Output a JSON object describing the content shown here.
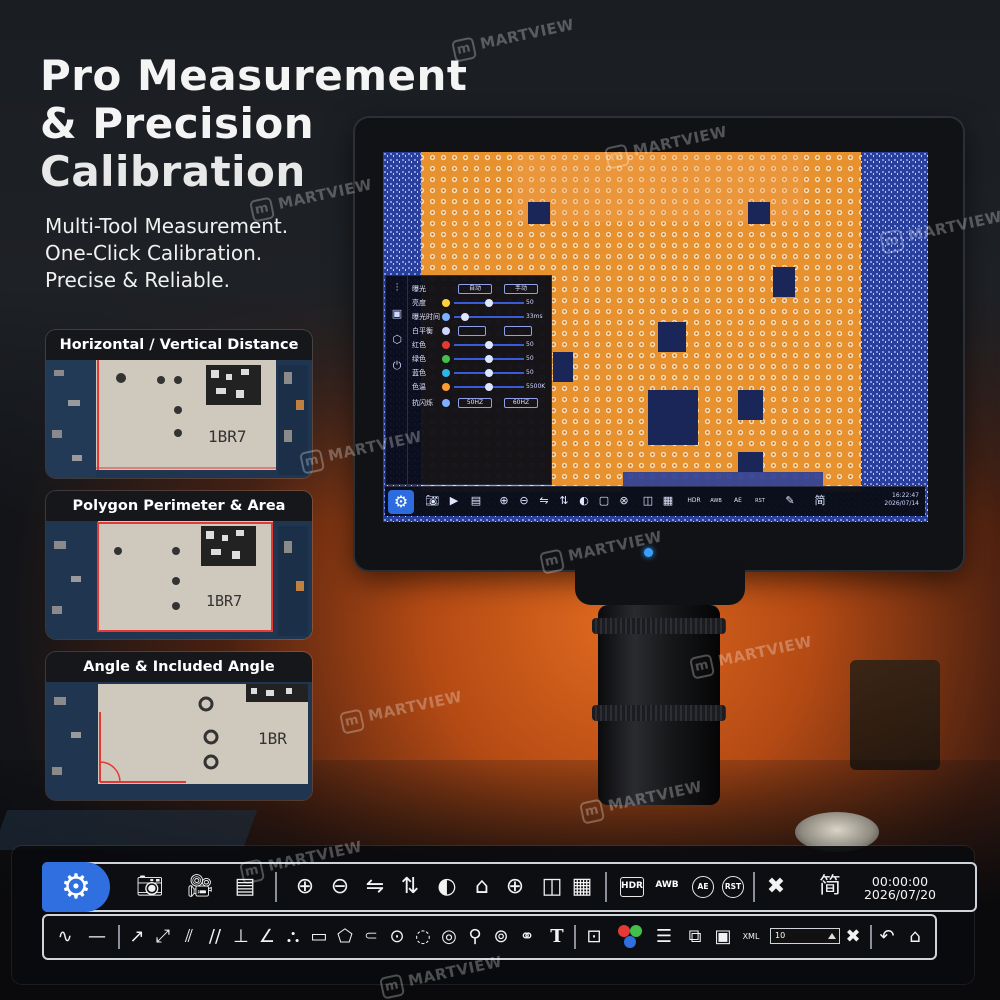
{
  "hero": {
    "title_line1": "Pro Measurement",
    "title_line2": "& Precision",
    "title_line3": "Calibration",
    "subtitle_line1": "Multi-Tool Measurement.",
    "subtitle_line2": "One-Click Calibration.",
    "subtitle_line3": "Precise & Reliable."
  },
  "cards": [
    {
      "label": "Horizontal / Vertical Distance",
      "chip_text": "1BR7"
    },
    {
      "label": "Polygon Perimeter & Area",
      "chip_text": "1BR7"
    },
    {
      "label": "Angle & Included Angle",
      "chip_text": "1BR"
    }
  ],
  "osd": {
    "rows": [
      {
        "label": "曝光",
        "left_option": "自动",
        "right_option": "手动"
      },
      {
        "label": "亮度",
        "value": "50",
        "level": 0.5,
        "icon_color": "#ffd23a"
      },
      {
        "label": "曝光时间",
        "value": "33ms",
        "level": 0.15,
        "icon_color": "#7fb0ff"
      },
      {
        "label": "白平衡",
        "value": "",
        "icon_color": "#cfd6ff"
      },
      {
        "label": "红色",
        "value": "50",
        "level": 0.5,
        "icon_color": "#e53935"
      },
      {
        "label": "绿色",
        "value": "50",
        "level": 0.5,
        "icon_color": "#43c04a"
      },
      {
        "label": "蓝色",
        "value": "50",
        "level": 0.5,
        "icon_color": "#2fb6e8"
      },
      {
        "label": "色温",
        "value": "5500K",
        "level": 0.5,
        "icon_color": "#ff9a2e"
      },
      {
        "label": "抗闪烁",
        "left_option": "50HZ",
        "right_option": "60HZ"
      }
    ]
  },
  "screen_toolbar": {
    "time": "16:22:47",
    "date": "2026/07/14",
    "lang": "简"
  },
  "toolbar": {
    "time": "00:00:00",
    "date": "2026/07/20",
    "lang_label": "简",
    "hdr_label": "HDR",
    "awb_label": "AWB",
    "ae_label": "AE",
    "rst_label": "RST",
    "xml_label": "XML",
    "line_width_value": "10",
    "text_tool_label": "T"
  },
  "watermark": {
    "brand": "MARTVIEW",
    "logo_letter": "m"
  },
  "colors": {
    "accent_blue": "#2f6fe0",
    "orange_bg": "#e0691f",
    "pcb_gold": "#f0a050",
    "screen_blue": "#2a3f9a"
  }
}
